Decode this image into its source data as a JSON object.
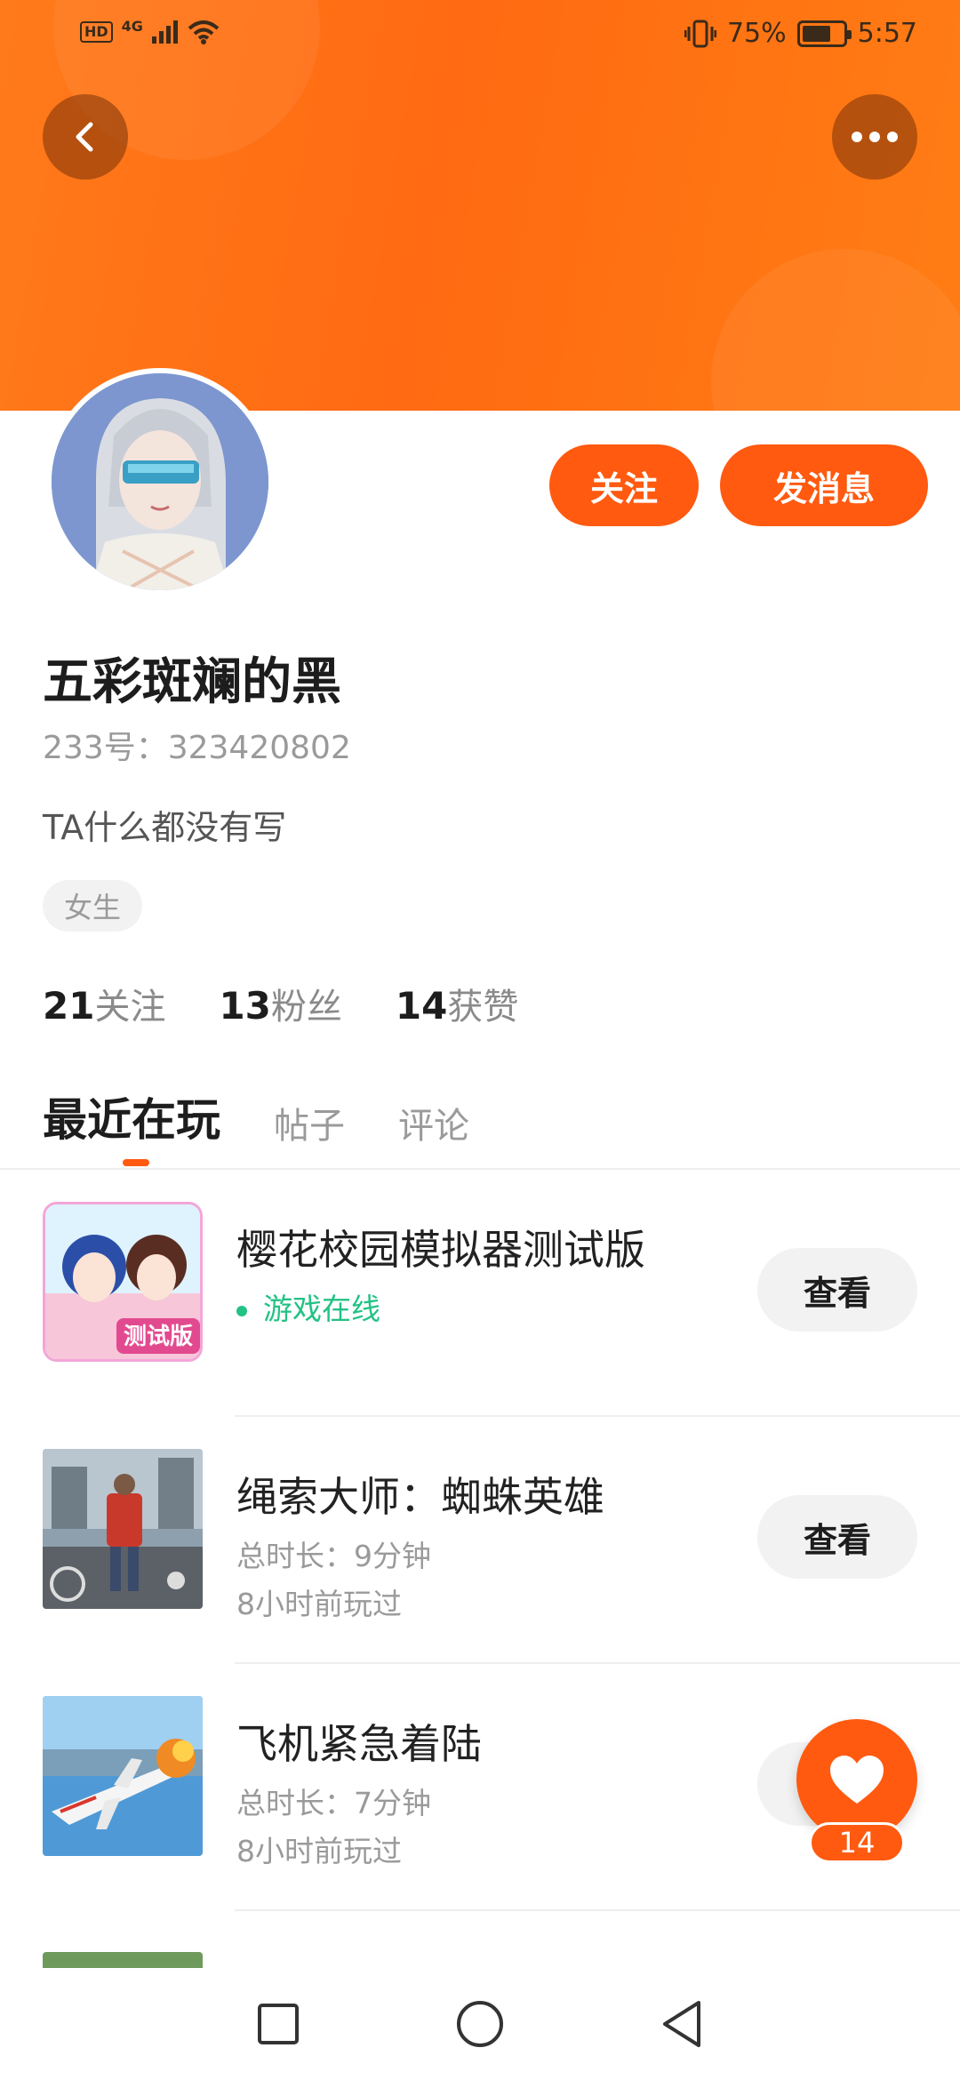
{
  "status_bar": {
    "hd": "HD",
    "network": "4G",
    "battery_percent": "75%",
    "battery_level": 0.75,
    "time": "5:57"
  },
  "profile": {
    "follow_label": "关注",
    "message_label": "发消息",
    "username": "五彩斑斓的黑",
    "uid": "233号：323420802",
    "bio": "TA什么都没有写",
    "gender": "女生",
    "stats": [
      {
        "count": "21",
        "label": "关注"
      },
      {
        "count": "13",
        "label": "粉丝"
      },
      {
        "count": "14",
        "label": "获赞"
      }
    ]
  },
  "tabs": [
    "最近在玩",
    "帖子",
    "评论"
  ],
  "games": [
    {
      "name": "樱花校园模拟器测试版",
      "line1": "游戏在线",
      "line2": "",
      "action": "查看"
    },
    {
      "name": "绳索大师：蜘蛛英雄",
      "line1": "总时长：9分钟",
      "line2": "8小时前玩过",
      "action": "查看"
    },
    {
      "name": "飞机紧急着陆",
      "line1": "总时长：7分钟",
      "line2": "8小时前玩过",
      "action": "查看"
    }
  ],
  "like_fab": {
    "count": "14"
  },
  "colors": {
    "accent": "#ff5a10",
    "online": "#23c285"
  }
}
